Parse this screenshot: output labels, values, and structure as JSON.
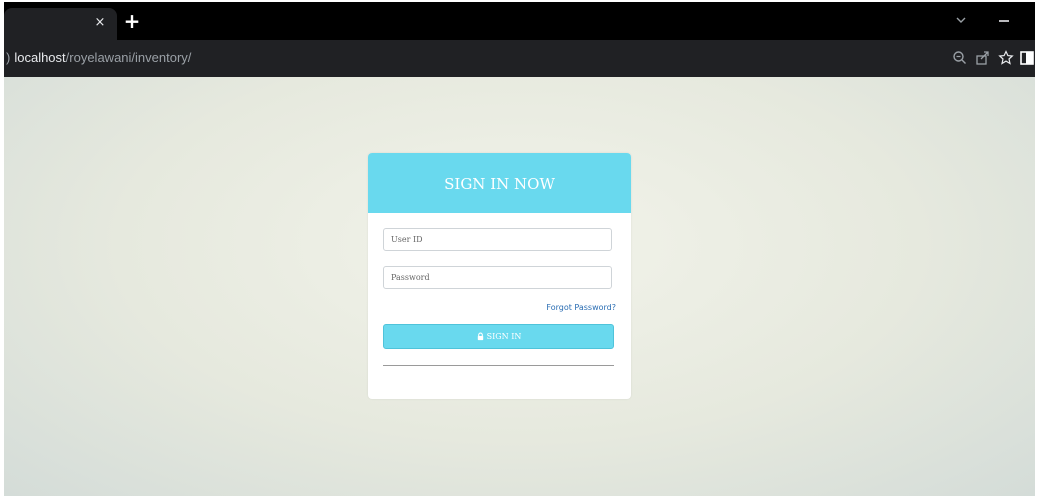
{
  "browser": {
    "tab": {
      "close_glyph": "×",
      "close_icon": "close-icon"
    },
    "new_tab_glyph": "+",
    "address": {
      "host": "localhost",
      "path": "/royelawani/inventory/"
    },
    "toolbar_icons": [
      "zoom-icon",
      "share-icon",
      "bookmark-star-icon",
      "side-panel-icon"
    ]
  },
  "login": {
    "title": "SIGN IN NOW",
    "user_placeholder": "User ID",
    "password_placeholder": "Password",
    "forgot_label": "Forgot Password?",
    "signin_label": "SIGN IN",
    "signin_icon": "lock-icon"
  },
  "colors": {
    "accent": "#69d9ee",
    "link": "#2a6db3",
    "browser_dark": "#202124"
  }
}
